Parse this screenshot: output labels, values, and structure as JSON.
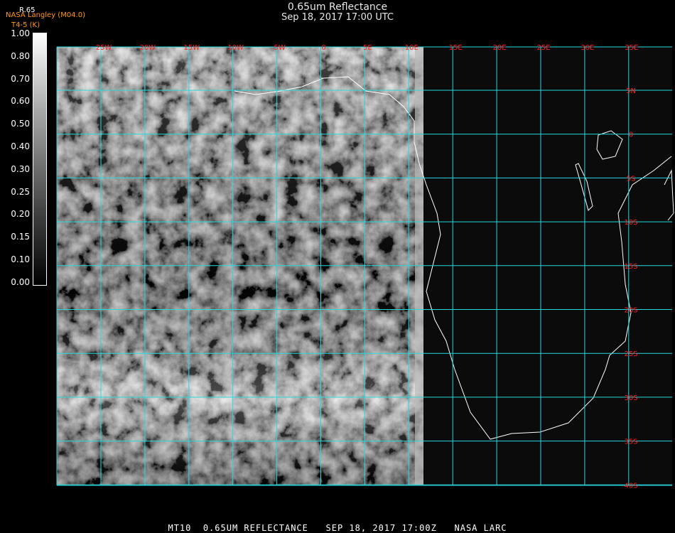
{
  "header": {
    "title": "0.65um Reflectance",
    "subtitle": "Sep 18, 2017 17:00 UTC",
    "credit_line0": "R.65",
    "credit_line1": "NASA Langley (M04.0)",
    "credit_line2": "T4-5 (K)"
  },
  "colorbar": {
    "ticks": [
      "1.00",
      "0.80",
      "0.70",
      "0.60",
      "0.50",
      "0.40",
      "0.30",
      "0.25",
      "0.20",
      "0.15",
      "0.10",
      "0.00"
    ]
  },
  "map": {
    "lon_labels": [
      "25W",
      "20W",
      "15W",
      "10W",
      "5W",
      "0",
      "5E",
      "10E",
      "15E",
      "20E",
      "25E",
      "30E",
      "35E"
    ],
    "lat_labels": [
      "5N",
      "0",
      "5S",
      "10S",
      "15S",
      "20S",
      "25S",
      "30S",
      "35S",
      "40S"
    ],
    "grid_color": "#27d8e0",
    "label_color": "#ff2222"
  },
  "footer": {
    "text": "MT10  0.65UM REFLECTANCE   SEP 18, 2017 17:00Z   NASA LARC"
  }
}
